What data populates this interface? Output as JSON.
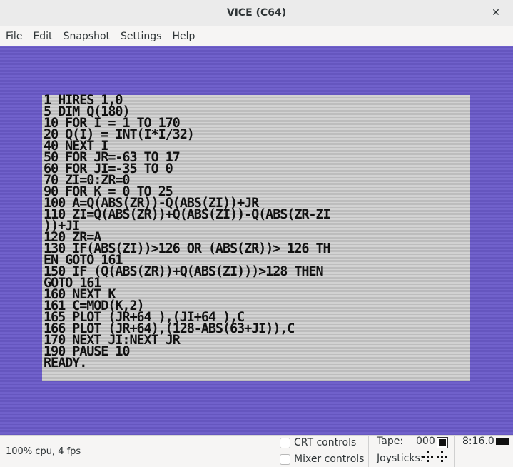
{
  "window": {
    "title": "VICE (C64)"
  },
  "menu": [
    "File",
    "Edit",
    "Snapshot",
    "Settings",
    "Help"
  ],
  "c64": {
    "border_color": "#6a5bc9",
    "screen_color": "#c9c9c9",
    "lines": [
      "1 HIRES 1,0",
      "5 DIM Q(180)",
      "10 FOR I = 1 TO 170",
      "20 Q(I) = INT(I*I/32)",
      "40 NEXT I",
      "50 FOR JR=-63 TO 17",
      "60 FOR JI=-35 TO 0",
      "70 ZI=0:ZR=0",
      "90 FOR K = 0 TO 25",
      "100 A=Q(ABS(ZR))-Q(ABS(ZI))+JR",
      "110 ZI=Q(ABS(ZR))+Q(ABS(ZI))-Q(ABS(ZR-ZI",
      "))+JI",
      "120 ZR=A",
      "130 IF(ABS(ZI))>126 OR (ABS(ZR))> 126 TH",
      "EN GOTO 161",
      "150 IF (Q(ABS(ZR))+Q(ABS(ZI)))>128 THEN",
      "GOTO 161",
      "160 NEXT K",
      "161 C=MOD(K,2)",
      "165 PLOT (JR+64 ),(JI+64 ),C",
      "166 PLOT (JR+64),(128-ABS(63+JI)),C",
      "170 NEXT JI:NEXT JR",
      "190 PAUSE 10",
      "READY."
    ]
  },
  "status": {
    "cpu": "100% cpu, 4 fps",
    "crt_label": "CRT controls",
    "mixer_label": "Mixer controls",
    "tape_label": "Tape:",
    "tape_counter": "000",
    "joysticks_label": "Joysticks:",
    "speed": "8:16.0"
  }
}
